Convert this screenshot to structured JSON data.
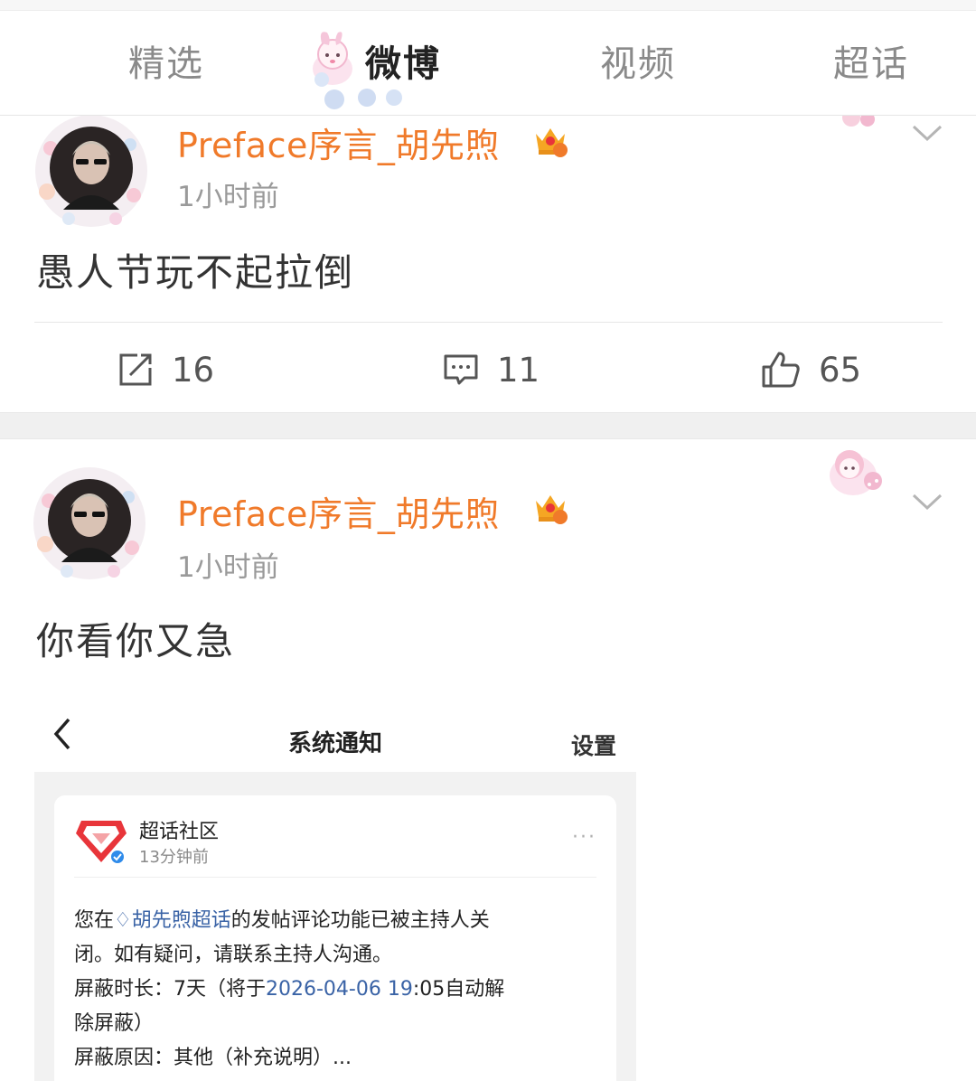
{
  "tabs": [
    {
      "label": "精选",
      "active": false
    },
    {
      "label": "微博",
      "active": true
    },
    {
      "label": "视频",
      "active": false
    },
    {
      "label": "超话",
      "active": false
    }
  ],
  "posts": [
    {
      "username": "Preface序言_胡先煦",
      "time": "1小时前",
      "text": "愚人节玩不起拉倒",
      "reposts": "16",
      "comments": "11",
      "likes": "65"
    },
    {
      "username": "Preface序言_胡先煦",
      "time": "1小时前",
      "text": "你看你又急"
    }
  ],
  "embed": {
    "title": "系统通知",
    "settings": "设置",
    "sender": "超话社区",
    "time": "13分钟前",
    "more": "···",
    "line1_prefix": "您在",
    "line1_link": "胡先煦超话",
    "line1_suffix": "的发帖评论功能已被主持人关",
    "line2": "闭。如有疑问，请联系主持人沟通。",
    "line3_prefix": "屏蔽时长：7天（将于",
    "line3_date": "2026-04-06 19",
    "line3_suffix": ":05自动解",
    "line4": "除屏蔽）",
    "line5": "屏蔽原因：其他（补充说明）..."
  },
  "colors": {
    "username": "#f07a2a",
    "link": "#3a63a6",
    "accent_red": "#e8353a"
  },
  "icons": {
    "repost": "share-icon",
    "comment": "comment-icon",
    "like": "thumbs-up-icon",
    "more": "chevron-down-icon",
    "back": "back-arrow-icon"
  }
}
